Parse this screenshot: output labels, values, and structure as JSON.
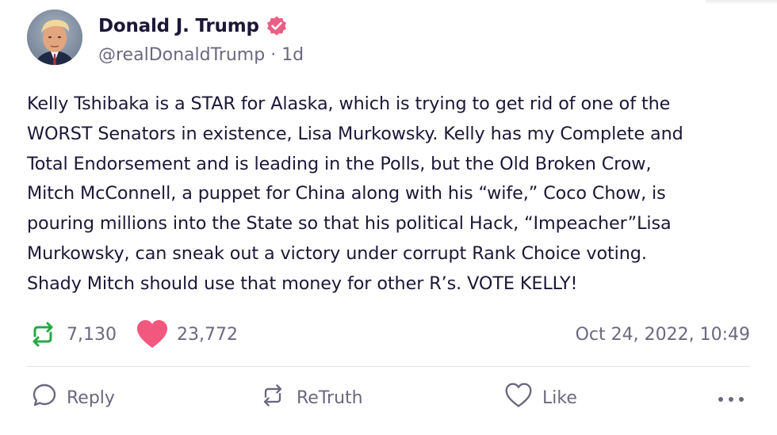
{
  "author": {
    "display_name": "Donald J. Trump",
    "handle": "@realDonaldTrump",
    "separator": "·",
    "age": "1d",
    "verified": true,
    "verified_color": "#ec5d82"
  },
  "post": {
    "text": "Kelly Tshibaka is a STAR for Alaska, which is trying to get rid of one of the\nWORST Senators in existence, Lisa Murkowsky. Kelly has my Complete and\nTotal Endorsement and is leading in the Polls, but the Old Broken Crow,\nMitch McConnell, a puppet for China along with his “wife,” Coco Chow, is\npouring millions into the State so that his political Hack, “Impeacher”Lisa\nMurkowsky, can sneak out a victory under corrupt Rank Choice voting.\nShady Mitch should use that money for other R’s. VOTE KELLY!"
  },
  "stats": {
    "retruths": "7,130",
    "likes": "23,772",
    "timestamp": "Oct 24, 2022, 10:49",
    "retruth_icon": "retruth-icon",
    "like_icon": "heart-filled-icon",
    "retruth_color": "#27a844",
    "like_color": "#f2587d"
  },
  "actions": {
    "reply_label": "Reply",
    "retruth_label": "ReTruth",
    "like_label": "Like",
    "reply_icon": "comment-bubble-icon",
    "retruth_icon": "retruth-icon",
    "like_icon": "heart-outline-icon",
    "more_icon": "more-dots-icon"
  }
}
